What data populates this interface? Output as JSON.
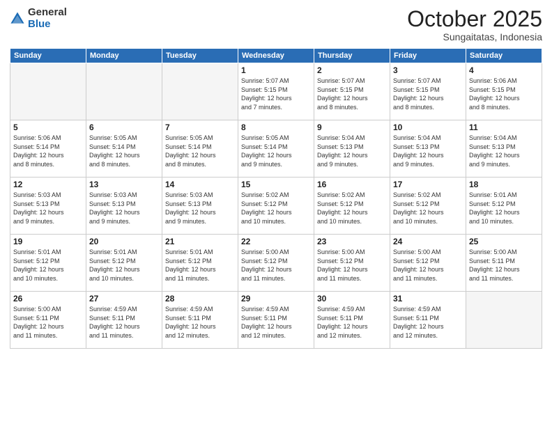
{
  "logo": {
    "general": "General",
    "blue": "Blue"
  },
  "header": {
    "month": "October 2025",
    "location": "Sungaitatas, Indonesia"
  },
  "weekdays": [
    "Sunday",
    "Monday",
    "Tuesday",
    "Wednesday",
    "Thursday",
    "Friday",
    "Saturday"
  ],
  "weeks": [
    [
      {
        "day": "",
        "info": ""
      },
      {
        "day": "",
        "info": ""
      },
      {
        "day": "",
        "info": ""
      },
      {
        "day": "1",
        "info": "Sunrise: 5:07 AM\nSunset: 5:15 PM\nDaylight: 12 hours\nand 7 minutes."
      },
      {
        "day": "2",
        "info": "Sunrise: 5:07 AM\nSunset: 5:15 PM\nDaylight: 12 hours\nand 8 minutes."
      },
      {
        "day": "3",
        "info": "Sunrise: 5:07 AM\nSunset: 5:15 PM\nDaylight: 12 hours\nand 8 minutes."
      },
      {
        "day": "4",
        "info": "Sunrise: 5:06 AM\nSunset: 5:15 PM\nDaylight: 12 hours\nand 8 minutes."
      }
    ],
    [
      {
        "day": "5",
        "info": "Sunrise: 5:06 AM\nSunset: 5:14 PM\nDaylight: 12 hours\nand 8 minutes."
      },
      {
        "day": "6",
        "info": "Sunrise: 5:05 AM\nSunset: 5:14 PM\nDaylight: 12 hours\nand 8 minutes."
      },
      {
        "day": "7",
        "info": "Sunrise: 5:05 AM\nSunset: 5:14 PM\nDaylight: 12 hours\nand 8 minutes."
      },
      {
        "day": "8",
        "info": "Sunrise: 5:05 AM\nSunset: 5:14 PM\nDaylight: 12 hours\nand 9 minutes."
      },
      {
        "day": "9",
        "info": "Sunrise: 5:04 AM\nSunset: 5:13 PM\nDaylight: 12 hours\nand 9 minutes."
      },
      {
        "day": "10",
        "info": "Sunrise: 5:04 AM\nSunset: 5:13 PM\nDaylight: 12 hours\nand 9 minutes."
      },
      {
        "day": "11",
        "info": "Sunrise: 5:04 AM\nSunset: 5:13 PM\nDaylight: 12 hours\nand 9 minutes."
      }
    ],
    [
      {
        "day": "12",
        "info": "Sunrise: 5:03 AM\nSunset: 5:13 PM\nDaylight: 12 hours\nand 9 minutes."
      },
      {
        "day": "13",
        "info": "Sunrise: 5:03 AM\nSunset: 5:13 PM\nDaylight: 12 hours\nand 9 minutes."
      },
      {
        "day": "14",
        "info": "Sunrise: 5:03 AM\nSunset: 5:13 PM\nDaylight: 12 hours\nand 9 minutes."
      },
      {
        "day": "15",
        "info": "Sunrise: 5:02 AM\nSunset: 5:12 PM\nDaylight: 12 hours\nand 10 minutes."
      },
      {
        "day": "16",
        "info": "Sunrise: 5:02 AM\nSunset: 5:12 PM\nDaylight: 12 hours\nand 10 minutes."
      },
      {
        "day": "17",
        "info": "Sunrise: 5:02 AM\nSunset: 5:12 PM\nDaylight: 12 hours\nand 10 minutes."
      },
      {
        "day": "18",
        "info": "Sunrise: 5:01 AM\nSunset: 5:12 PM\nDaylight: 12 hours\nand 10 minutes."
      }
    ],
    [
      {
        "day": "19",
        "info": "Sunrise: 5:01 AM\nSunset: 5:12 PM\nDaylight: 12 hours\nand 10 minutes."
      },
      {
        "day": "20",
        "info": "Sunrise: 5:01 AM\nSunset: 5:12 PM\nDaylight: 12 hours\nand 10 minutes."
      },
      {
        "day": "21",
        "info": "Sunrise: 5:01 AM\nSunset: 5:12 PM\nDaylight: 12 hours\nand 11 minutes."
      },
      {
        "day": "22",
        "info": "Sunrise: 5:00 AM\nSunset: 5:12 PM\nDaylight: 12 hours\nand 11 minutes."
      },
      {
        "day": "23",
        "info": "Sunrise: 5:00 AM\nSunset: 5:12 PM\nDaylight: 12 hours\nand 11 minutes."
      },
      {
        "day": "24",
        "info": "Sunrise: 5:00 AM\nSunset: 5:12 PM\nDaylight: 12 hours\nand 11 minutes."
      },
      {
        "day": "25",
        "info": "Sunrise: 5:00 AM\nSunset: 5:11 PM\nDaylight: 12 hours\nand 11 minutes."
      }
    ],
    [
      {
        "day": "26",
        "info": "Sunrise: 5:00 AM\nSunset: 5:11 PM\nDaylight: 12 hours\nand 11 minutes."
      },
      {
        "day": "27",
        "info": "Sunrise: 4:59 AM\nSunset: 5:11 PM\nDaylight: 12 hours\nand 11 minutes."
      },
      {
        "day": "28",
        "info": "Sunrise: 4:59 AM\nSunset: 5:11 PM\nDaylight: 12 hours\nand 12 minutes."
      },
      {
        "day": "29",
        "info": "Sunrise: 4:59 AM\nSunset: 5:11 PM\nDaylight: 12 hours\nand 12 minutes."
      },
      {
        "day": "30",
        "info": "Sunrise: 4:59 AM\nSunset: 5:11 PM\nDaylight: 12 hours\nand 12 minutes."
      },
      {
        "day": "31",
        "info": "Sunrise: 4:59 AM\nSunset: 5:11 PM\nDaylight: 12 hours\nand 12 minutes."
      },
      {
        "day": "",
        "info": ""
      }
    ]
  ]
}
